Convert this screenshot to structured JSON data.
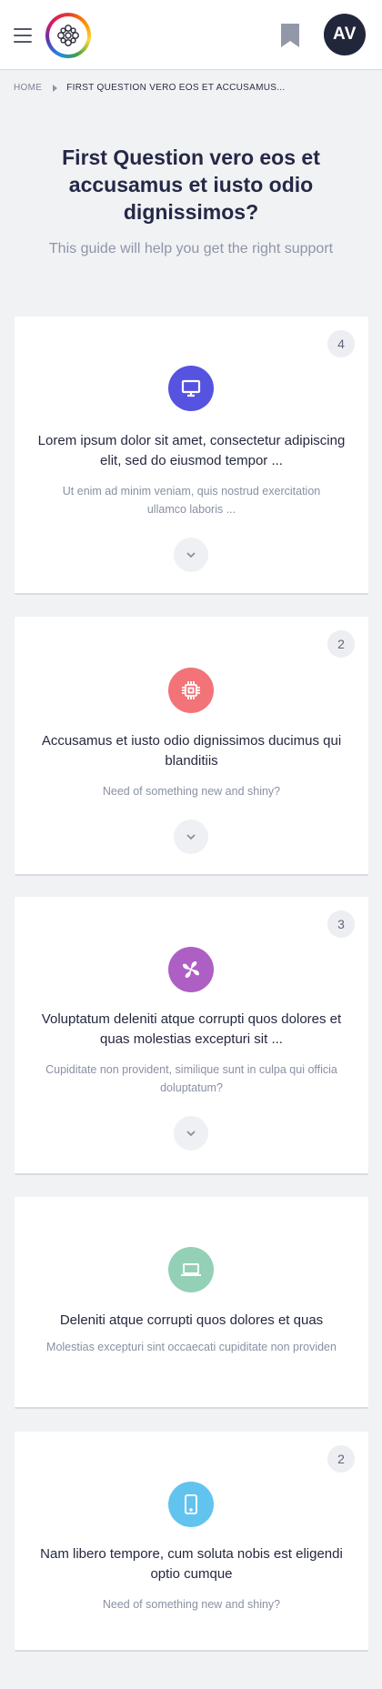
{
  "header": {
    "menu_icon": "hamburger-menu-icon",
    "logo_icon": "colorful-ring-logo",
    "bookmark_icon": "bookmark-icon",
    "avatar_initials": "AV"
  },
  "breadcrumb": {
    "home": "HOME",
    "current": "FIRST QUESTION VERO EOS ET ACCUSAMUS..."
  },
  "page": {
    "title": "First Question vero eos et accusamus et iusto odio dignissimos?",
    "subtitle": "This guide will help you get the right support"
  },
  "cards": [
    {
      "count": "4",
      "icon": "monitor-icon",
      "icon_color": "#5553e0",
      "title": "Lorem ipsum dolor sit amet, consectetur adipiscing elit, sed do eiusmod tempor ...",
      "description": "Ut enim ad minim veniam, quis nostrud exercitation ullamco laboris ...",
      "expandable": true
    },
    {
      "count": "2",
      "icon": "cpu-chip-icon",
      "icon_color": "#f27378",
      "title": "Accusamus et iusto odio dignissimos ducimus qui blanditiis",
      "description": "Need of something new and shiny?",
      "expandable": true
    },
    {
      "count": "3",
      "icon": "pinwheel-icon",
      "icon_color": "#ae5fc4",
      "title": "Voluptatum deleniti atque corrupti quos dolores et quas molestias excepturi sit ...",
      "description": "Cupiditate non provident, similique sunt in culpa qui officia doluptatum?",
      "expandable": true
    },
    {
      "count": "",
      "icon": "laptop-icon",
      "icon_color": "#93d0b6",
      "title": "Deleniti atque corrupti quos dolores et quas",
      "description": "Molestias excepturi sint occaecati cupiditate non providen",
      "expandable": false
    },
    {
      "count": "2",
      "icon": "tablet-icon",
      "icon_color": "#62c3ef",
      "title": "Nam libero tempore, cum soluta nobis est eligendi optio cumque",
      "description": "Need of something new and shiny?",
      "expandable": false
    }
  ]
}
